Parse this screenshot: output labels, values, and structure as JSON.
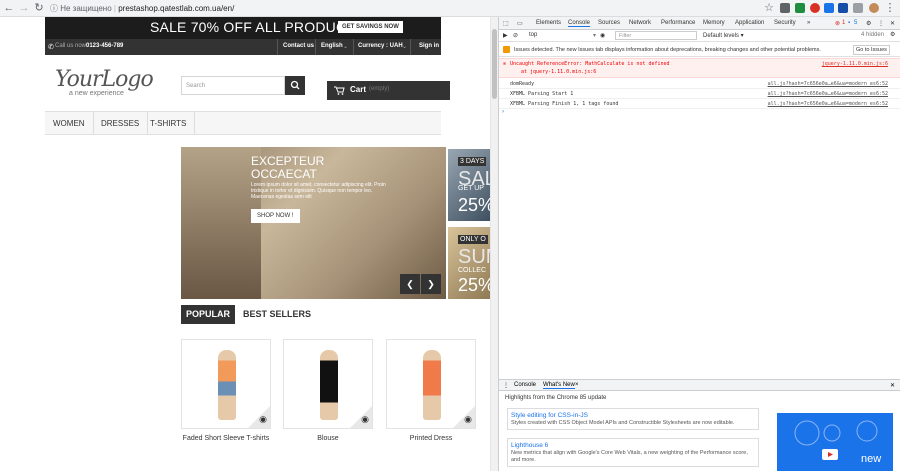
{
  "browser": {
    "security": "Не защищено",
    "url": "prestashop.qatestlab.com.ua/en/"
  },
  "shop": {
    "banner_text": "SALE 70% OFF ALL PRODUCTS",
    "banner_cta": "GET SAVINGS NOW",
    "call_label": "Call us now:",
    "phone": "0123-456-789",
    "contact": "Contact us",
    "language": "English",
    "currency": "Currency : UAH",
    "signin": "Sign in",
    "logo_main": "YourLogo",
    "logo_sub": "a new experience",
    "search_placeholder": "Search",
    "cart_label": "Cart",
    "cart_state": "(empty)",
    "menu": [
      "WOMEN",
      "DRESSES",
      "T-SHIRTS"
    ],
    "slide": {
      "heading1": "EXCEPTEUR",
      "heading2": "OCCAECAT",
      "text": "Lorem ipsum dolor sit amet, consectetur adipiscing elit. Proin tristique in tortor et dignissim. Quisque non tempor leo. Maecenas egestas sem elit",
      "button": "SHOP NOW !"
    },
    "side1_label": "3 DAYS",
    "side1_big": "SAL",
    "side1_sub": "GET UP",
    "side1_pct": "25%",
    "side2_label": "ONLY O",
    "side2_big": "SUM",
    "side2_sub": "COLLEC",
    "side2_pct": "25%",
    "tabs": [
      "POPULAR",
      "BEST SELLERS"
    ],
    "products": [
      "Faded Short Sleeve T-shirts",
      "Blouse",
      "Printed Dress"
    ]
  },
  "devtools": {
    "tabs": [
      "Elements",
      "Console",
      "Sources",
      "Network",
      "Performance",
      "Memory",
      "Application",
      "Security"
    ],
    "error_count": "1",
    "issue_count": "5",
    "context": "top",
    "filter_placeholder": "Filter",
    "levels": "Default levels ▾",
    "hidden": "4 hidden",
    "issues_text": "Issues detected. The new Issues tab displays information about deprecations, breaking changes and other potential problems.",
    "issues_button": "Go to Issues",
    "error_line1": "Uncaught ReferenceError: MathCalculate is not defined",
    "error_line2": "at jquery-1.11.0.min.js:6",
    "error_src": "jquery-1.11.0.min.js:6",
    "logs": [
      {
        "msg": "domReady",
        "src": "all.js?hash=7c656e0a…e6&ua=modern_es6:52"
      },
      {
        "msg": "XFBML Parsing Start 1",
        "src": "all.js?hash=7c656e0a…e6&ua=modern_es6:52"
      },
      {
        "msg": "XFBML Parsing Finish 1, 1 tags found",
        "src": "all.js?hash=7c656e0a…e6&ua=modern_es6:52"
      }
    ],
    "drawer_tabs": [
      "Console",
      "What's New"
    ],
    "highlights": "Highlights from the Chrome 85 update",
    "cards": [
      {
        "title": "Style editing for CSS-in-JS",
        "text": "Styles created with CSS Object Model APIs and Constructible Stylesheets are now editable."
      },
      {
        "title": "Lighthouse 6",
        "text": "New metrics that align with Google's Core Web Vitals, a new weighting of the Performance score, and more."
      }
    ],
    "promo_text": "new"
  }
}
